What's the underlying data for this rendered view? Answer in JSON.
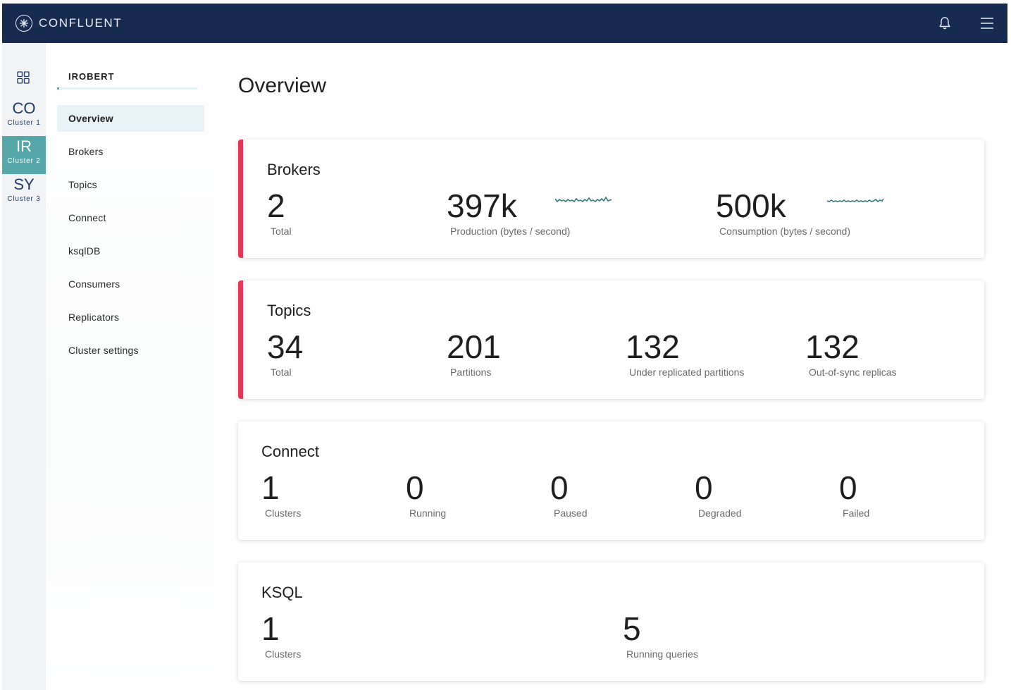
{
  "header": {
    "brand": "CONFLUENT",
    "brand_color": "#172a4f"
  },
  "rail": {
    "clusters": [
      {
        "abbr": "CO",
        "label": "Cluster 1",
        "active": false
      },
      {
        "abbr": "IR",
        "label": "Cluster 2",
        "active": true
      },
      {
        "abbr": "SY",
        "label": "Cluster 3",
        "active": false
      }
    ],
    "accent": "#55a7aa"
  },
  "nav": {
    "cluster_name": "IROBERT",
    "items": [
      {
        "label": "Overview",
        "active": true
      },
      {
        "label": "Brokers"
      },
      {
        "label": "Topics"
      },
      {
        "label": "Connect"
      },
      {
        "label": "ksqlDB"
      },
      {
        "label": "Consumers"
      },
      {
        "label": "Replicators"
      },
      {
        "label": "Cluster settings"
      }
    ]
  },
  "main": {
    "title": "Overview",
    "alert_color": "#e63658",
    "brokers": {
      "title": "Brokers",
      "total": {
        "value": "2",
        "label": "Total"
      },
      "production": {
        "value": "397k",
        "label": "Production (bytes / second)"
      },
      "consumption": {
        "value": "500k",
        "label": "Consumption (bytes / second)"
      }
    },
    "topics": {
      "title": "Topics",
      "total": {
        "value": "34",
        "label": "Total"
      },
      "partitions": {
        "value": "201",
        "label": "Partitions"
      },
      "under_replicated": {
        "value": "132",
        "label": "Under replicated partitions"
      },
      "out_of_sync": {
        "value": "132",
        "label": "Out-of-sync replicas"
      }
    },
    "connect": {
      "title": "Connect",
      "clusters": {
        "value": "1",
        "label": "Clusters"
      },
      "running": {
        "value": "0",
        "label": "Running"
      },
      "paused": {
        "value": "0",
        "label": "Paused"
      },
      "degraded": {
        "value": "0",
        "label": "Degraded"
      },
      "failed": {
        "value": "0",
        "label": "Failed"
      }
    },
    "ksql": {
      "title": "KSQL",
      "clusters": {
        "value": "1",
        "label": "Clusters"
      },
      "running_queries": {
        "value": "5",
        "label": "Running queries"
      }
    }
  }
}
